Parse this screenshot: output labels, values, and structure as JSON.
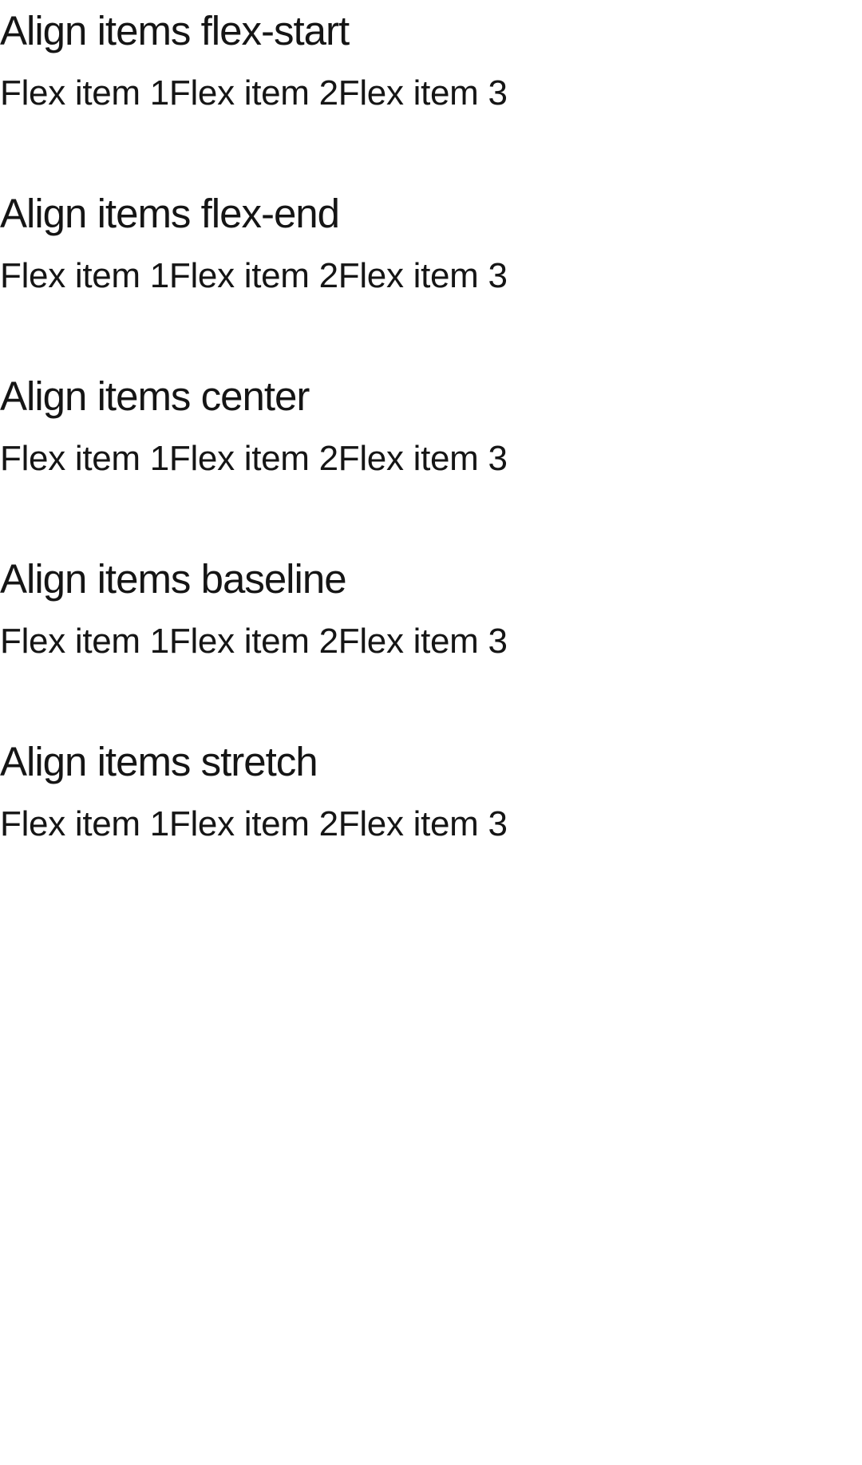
{
  "sections": [
    {
      "title": "Align items flex-start",
      "items": [
        "Flex item 1",
        "Flex item 2",
        "Flex item 3"
      ]
    },
    {
      "title": "Align items flex-end",
      "items": [
        "Flex item 1",
        "Flex item 2",
        "Flex item 3"
      ]
    },
    {
      "title": "Align items center",
      "items": [
        "Flex item 1",
        "Flex item 2",
        "Flex item 3"
      ]
    },
    {
      "title": "Align items baseline",
      "items": [
        "Flex item 1",
        "Flex item 2",
        "Flex item 3"
      ]
    },
    {
      "title": "Align items stretch",
      "items": [
        "Flex item 1",
        "Flex item 2",
        "Flex item 3"
      ]
    }
  ]
}
